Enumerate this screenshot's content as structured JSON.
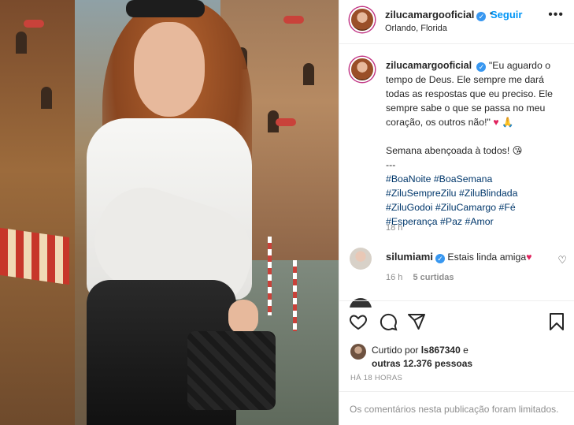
{
  "post": {
    "username": "zilucamargooficial",
    "follow_label": "Seguir",
    "dot": "•",
    "location": "Orlando, Florida",
    "more_label": "•••"
  },
  "caption": {
    "username": "zilucamargooficial",
    "quote": "\"Eu aguardo o tempo de Deus. Ele sempre me dará todas as respostas que eu preciso. Ele sempre sabe o que se passa no meu coração, os outros não!\"",
    "quote_emoji": "♥ 🙏",
    "line2": "Semana abençoada à todos! 😘",
    "separator": "---",
    "hashtags": [
      "#BoaNoite #BoaSemana",
      "#ZiluSempreZilu #ZiluBlindada",
      "#ZiluGodoi #ZiluCamargo #Fé",
      "#Esperança #Paz #Amor"
    ],
    "time": "18 h"
  },
  "comment": {
    "username": "silumiami",
    "text": "Estais linda amiga",
    "emoji": "♥",
    "time": "16 h",
    "likes": "5 curtidas"
  },
  "likes": {
    "prefix": "Curtido por",
    "user": "ls867340",
    "conj": "e",
    "others": "outras 12.376 pessoas"
  },
  "posted": "HÁ 18 HORAS",
  "comments_limited": "Os comentários nesta publicação foram limitados.",
  "icons": {
    "like": "heart-outline-icon",
    "comment": "speech-bubble-icon",
    "share": "paper-plane-icon",
    "save": "bookmark-icon",
    "verified": "verified-badge-icon",
    "more": "more-options-icon"
  },
  "colors": {
    "link_blue": "#0095f6",
    "hashtag": "#00376b",
    "muted": "#8e8e8e",
    "verified": "#3897f0",
    "heart": "#e0245e"
  }
}
